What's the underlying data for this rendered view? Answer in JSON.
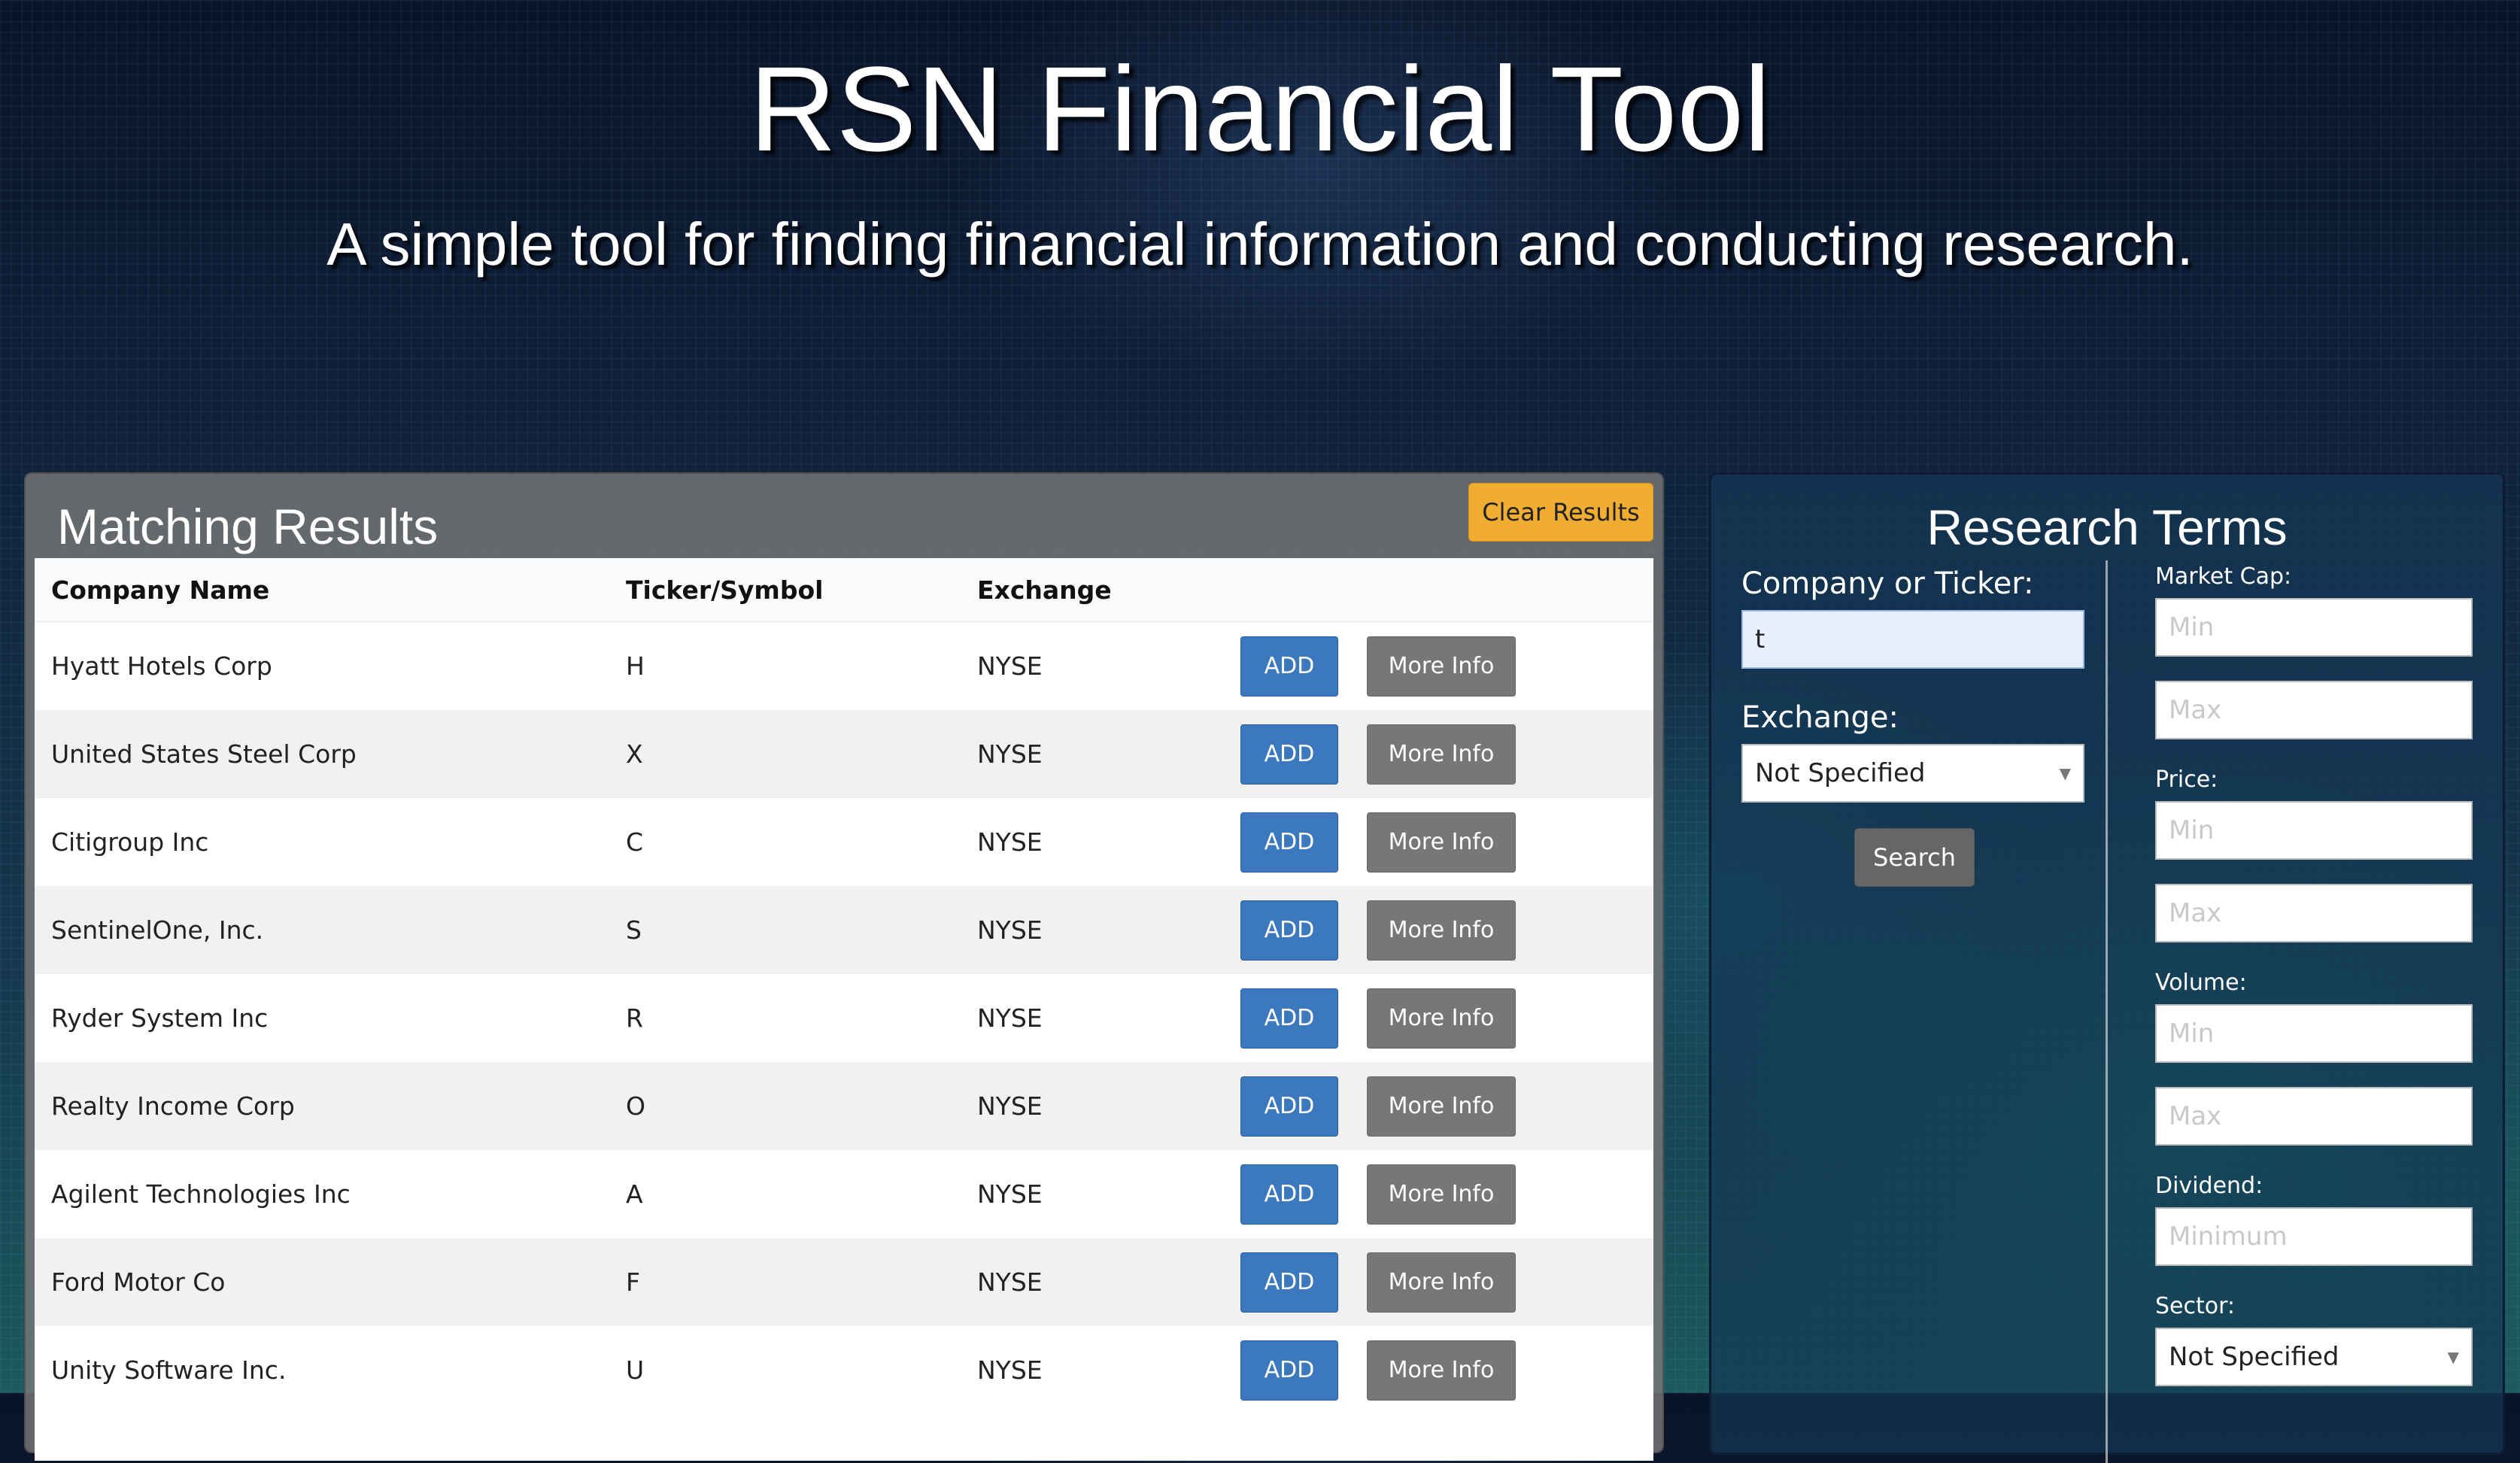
{
  "header": {
    "title": "RSN Financial Tool",
    "subtitle": "A simple tool for finding financial information and conducting research."
  },
  "results": {
    "title": "Matching Results",
    "clear_label": "Clear Results",
    "columns": [
      "Company Name",
      "Ticker/Symbol",
      "Exchange"
    ],
    "add_label": "ADD",
    "info_label": "More Info",
    "rows": [
      {
        "company": "Hyatt Hotels Corp",
        "ticker": "H",
        "exchange": "NYSE"
      },
      {
        "company": "United States Steel Corp",
        "ticker": "X",
        "exchange": "NYSE"
      },
      {
        "company": "Citigroup Inc",
        "ticker": "C",
        "exchange": "NYSE"
      },
      {
        "company": "SentinelOne, Inc.",
        "ticker": "S",
        "exchange": "NYSE"
      },
      {
        "company": "Ryder System Inc",
        "ticker": "R",
        "exchange": "NYSE"
      },
      {
        "company": "Realty Income Corp",
        "ticker": "O",
        "exchange": "NYSE"
      },
      {
        "company": "Agilent Technologies Inc",
        "ticker": "A",
        "exchange": "NYSE"
      },
      {
        "company": "Ford Motor Co",
        "ticker": "F",
        "exchange": "NYSE"
      },
      {
        "company": "Unity Software Inc.",
        "ticker": "U",
        "exchange": "NYSE"
      }
    ]
  },
  "research": {
    "title": "Research Terms",
    "company_label": "Company or Ticker:",
    "company_value": "t",
    "exchange_label": "Exchange:",
    "exchange_value": "Not Specified",
    "search_label": "Search",
    "market_cap_label": "Market Cap:",
    "price_label": "Price:",
    "volume_label": "Volume:",
    "dividend_label": "Dividend:",
    "sector_label": "Sector:",
    "sector_value": "Not Specified",
    "min_placeholder": "Min",
    "max_placeholder": "Max",
    "minimum_placeholder": "Minimum"
  },
  "colors": {
    "add_button": "#3b78bd",
    "info_button": "#777777",
    "clear_button": "#f0ad32"
  }
}
